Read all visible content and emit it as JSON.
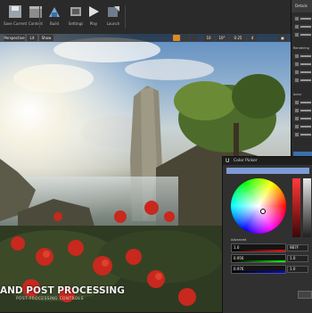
{
  "toolbar": {
    "buttons": [
      {
        "label": "Save Current",
        "icon": "save-icon"
      },
      {
        "label": "Content",
        "icon": "content-icon"
      },
      {
        "label": "Build",
        "icon": "build-icon"
      },
      {
        "label": "Settings",
        "icon": "settings-icon"
      },
      {
        "label": "Play",
        "icon": "play-icon"
      },
      {
        "label": "Launch",
        "icon": "launch-icon"
      }
    ]
  },
  "viewport": {
    "controls": [
      "Perspective",
      "Lit",
      "Show"
    ],
    "grid_value": "10",
    "angle_value": "10°",
    "scale_value": "0.25",
    "camera_speed": "4"
  },
  "outliner": {
    "title": "Details",
    "sections": [
      "Rendering",
      "Actor"
    ]
  },
  "color_picker": {
    "title": "Color Picker",
    "advanced_label": "Advanced",
    "fields": [
      {
        "value": "1.0",
        "hex": "9B7F"
      },
      {
        "value": "0.956",
        "hex": "1.0"
      },
      {
        "value": "0.976",
        "hex": "1.0"
      }
    ]
  },
  "caption": {
    "title": "AND POST PROCESSING",
    "subtitle": "POST-PROCESSING CONTROLS"
  }
}
